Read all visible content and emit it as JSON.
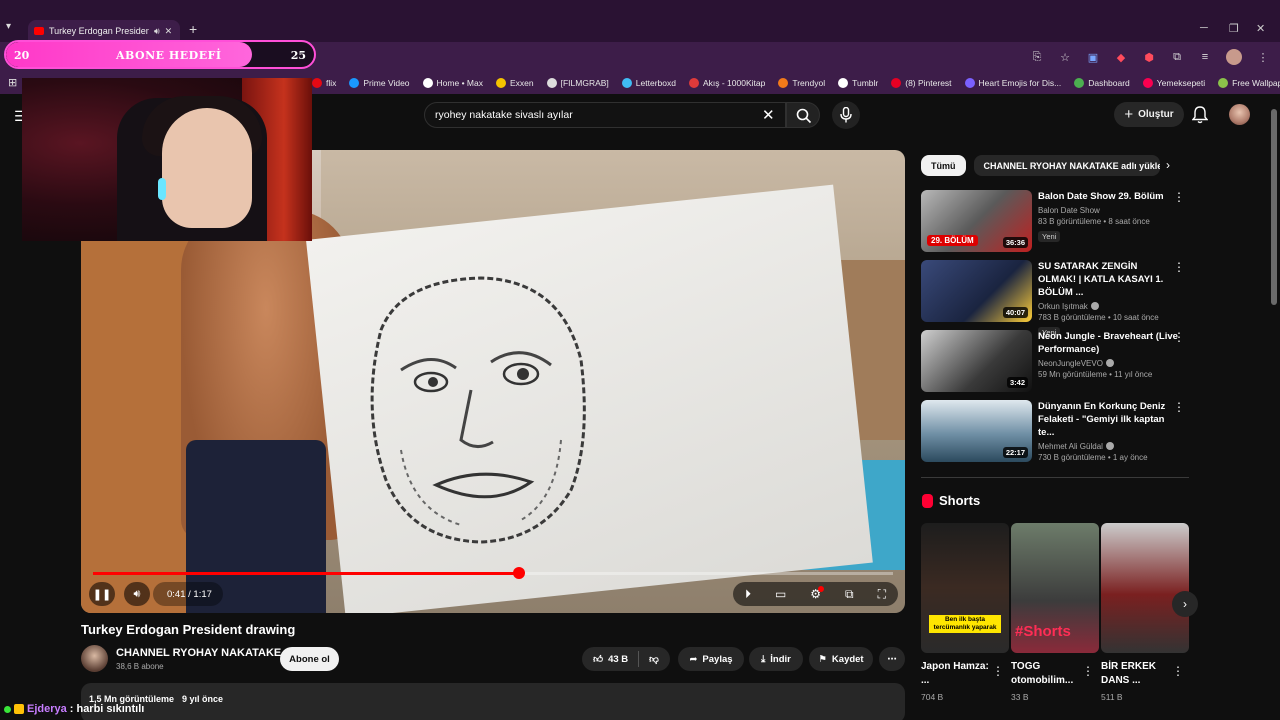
{
  "browser": {
    "tab_title": "Turkey Erdogan President d",
    "bookmarks": [
      {
        "label": "flix",
        "color": "#e50914"
      },
      {
        "label": "Prime Video",
        "color": "#1a98ff"
      },
      {
        "label": "Home • Max",
        "color": "#ffffff"
      },
      {
        "label": "Exxen",
        "color": "#f5c400"
      },
      {
        "label": "[FILMGRAB]",
        "color": "#dddddd"
      },
      {
        "label": "Letterboxd",
        "color": "#40bcf4"
      },
      {
        "label": "Akış - 1000Kitap",
        "color": "#e03a3a"
      },
      {
        "label": "Trendyol",
        "color": "#f27a1a"
      },
      {
        "label": "Tumblr",
        "color": "#ffffff"
      },
      {
        "label": "(8) Pinterest",
        "color": "#e60023"
      },
      {
        "label": "Heart Emojis for Dis...",
        "color": "#7b61ff"
      },
      {
        "label": "Dashboard",
        "color": "#4caf50"
      },
      {
        "label": "Yemeksepeti",
        "color": "#fa0050"
      },
      {
        "label": "Free Wallpapers HD...",
        "color": "#8bc34a"
      }
    ]
  },
  "overlay": {
    "goal_start": "20",
    "goal_title": "ABONE HEDEFİ",
    "goal_end": "25",
    "goal_progress": 0.8,
    "chat_user": "Ejderya",
    "chat_text": ": harbi sıkıntılı"
  },
  "header": {
    "search_query": "ryohey nakatake sivaslı ayılar",
    "create_label": "Oluştur"
  },
  "player": {
    "current_time": "0:41",
    "duration": "1:17",
    "progress": 0.532
  },
  "video": {
    "title": "Turkey Erdogan President drawing",
    "channel": "CHANNEL RYOHAY NAKATAKE",
    "subscribers": "38,6 B abone",
    "subscribe_label": "Abone ol",
    "likes": "43 B",
    "share_label": "Paylaş",
    "download_label": "İndir",
    "save_label": "Kaydet",
    "views": "1,5 Mn görüntüleme",
    "age": "9 yıl önce"
  },
  "sidebar": {
    "chips": [
      "Tümü",
      "CHANNEL RYOHAY NAKATAKE adlı yükley"
    ],
    "recommendations": [
      {
        "title": "Balon Date Show 29. Bölüm",
        "channel": "Balon Date Show",
        "meta": "83 B görüntüleme • 8 saat önce",
        "badge": "Yeni",
        "duration": "36:36",
        "thumb_label": "29. BÖLÜM",
        "verified": false
      },
      {
        "title": "SU SATARAK ZENGİN OLMAK! | KATLA KASAYI 1. BÖLÜM ...",
        "channel": "Orkun Işıtmak",
        "meta": "783 B görüntüleme • 10 saat önce",
        "badge": "Yeni",
        "duration": "40:07",
        "thumb_label": "",
        "verified": true
      },
      {
        "title": "Neon Jungle - Braveheart (Live Performance)",
        "channel": "NeonJungleVEVO",
        "meta": "59 Mn görüntüleme • 11 yıl önce",
        "badge": "",
        "duration": "3:42",
        "thumb_label": "",
        "verified": true
      },
      {
        "title": "Dünyanın En Korkunç Deniz Felaketi - \"Gemiyi ilk kaptan te...",
        "channel": "Mehmet Ali Güldal",
        "meta": "730 B görüntüleme • 1 ay önce",
        "badge": "",
        "duration": "22:17",
        "thumb_label": "",
        "verified": true
      }
    ],
    "shorts_heading": "Shorts",
    "shorts": [
      {
        "title": "Japon Hamza: ...",
        "views": "704 B",
        "overlay": "Ben ilk başta tercümanlık yaparak"
      },
      {
        "title": "TOGG otomobilim...",
        "views": "33 B",
        "overlay": "#Shorts"
      },
      {
        "title": "BİR ERKEK DANS ...",
        "views": "511 B",
        "overlay": ""
      }
    ]
  }
}
